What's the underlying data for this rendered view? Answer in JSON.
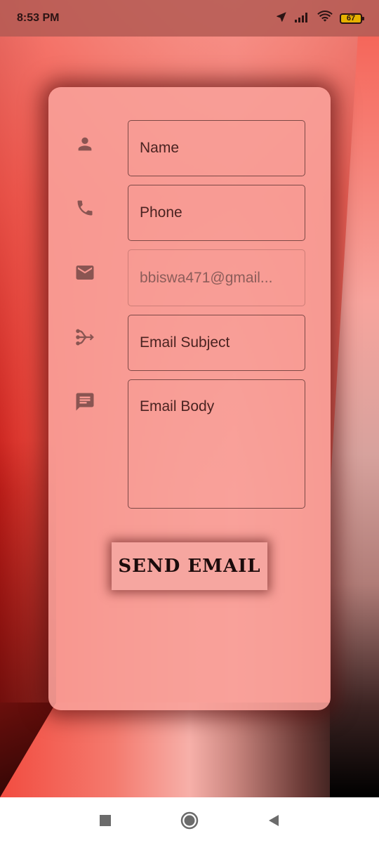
{
  "status_bar": {
    "time": "8:53 PM",
    "battery": "67",
    "icons": [
      "location-arrow-icon",
      "signal-icon",
      "wifi-icon",
      "battery-icon"
    ]
  },
  "form": {
    "name_placeholder": "Name",
    "phone_placeholder": "Phone",
    "email_value": "bbiswa471@gmail...",
    "subject_placeholder": "Email Subject",
    "body_placeholder": "Email Body",
    "icons": [
      "person-icon",
      "phone-icon",
      "mail-icon",
      "subject-icon",
      "message-icon"
    ]
  },
  "send_button": {
    "label": "SEND EMAIL"
  },
  "nav": {
    "icons": [
      "recents-square-icon",
      "home-circle-icon",
      "back-triangle-icon"
    ]
  },
  "colors": {
    "accent": "#f8a09a",
    "icon": "#8a5552",
    "field_border": "#7d4946"
  }
}
